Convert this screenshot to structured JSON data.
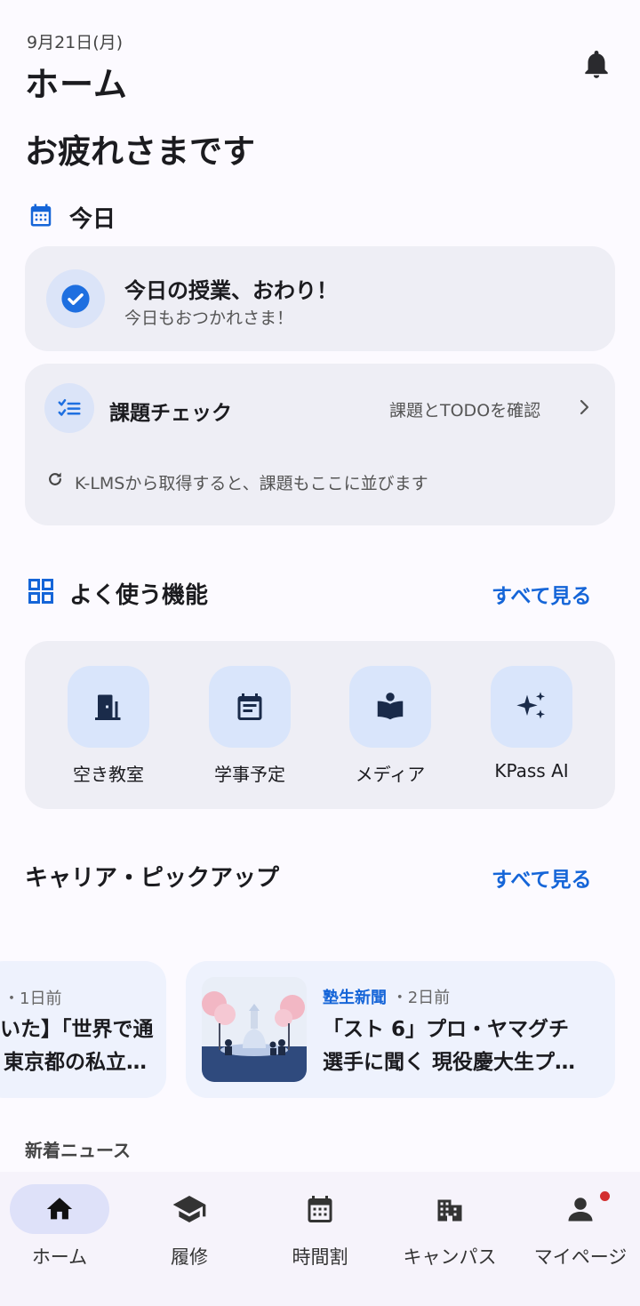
{
  "header": {
    "date": "9月21日(月)",
    "title": "ホーム",
    "bell_icon": "bell-icon"
  },
  "greeting": "お疲れさまです",
  "today": {
    "section_title": "今日",
    "section_icon": "calendar-icon",
    "classes_card": {
      "title": "今日の授業、おわり！",
      "subtitle": "今日もおつかれさま！"
    },
    "task_card": {
      "title": "課題チェック",
      "link": "課題とTODOを確認",
      "hint": "K-LMSから取得すると、課題もここに並びます"
    }
  },
  "features": {
    "section_title": "よく使う機能",
    "see_all": "すべて見る",
    "items": [
      {
        "label": "空き教室",
        "icon": "door-icon"
      },
      {
        "label": "学事予定",
        "icon": "calendar-note-icon"
      },
      {
        "label": "メディア",
        "icon": "book-reader-icon"
      },
      {
        "label": "KPass AI",
        "icon": "sparkle-icon"
      }
    ]
  },
  "career": {
    "section_title": "キャリア・ピックアップ",
    "see_all": "すべて見る",
    "cards": [
      {
        "source": "",
        "ago": "1日前",
        "line1": "いた】「世界で通",
        "line2": "東京都の私立…"
      },
      {
        "source": "塾生新聞",
        "ago": "2日前",
        "line1": "「スト 6」プロ・ヤマグチ",
        "line2": "選手に聞く 現役慶大生プ…"
      }
    ]
  },
  "news": {
    "title": "新着ニュース"
  },
  "nav": {
    "items": [
      {
        "label": "ホーム",
        "icon": "home-icon",
        "active": true
      },
      {
        "label": "履修",
        "icon": "graduation-cap-icon",
        "active": false
      },
      {
        "label": "時間割",
        "icon": "calendar-icon",
        "active": false
      },
      {
        "label": "キャンパス",
        "icon": "building-icon",
        "active": false
      },
      {
        "label": "マイページ",
        "icon": "person-icon",
        "active": false
      }
    ]
  },
  "colors": {
    "accent": "#1565d8",
    "icon_dark": "#1a2b4a",
    "background": "#fcfaff",
    "card": "#eeeef5",
    "badge": "#d32f2f"
  }
}
